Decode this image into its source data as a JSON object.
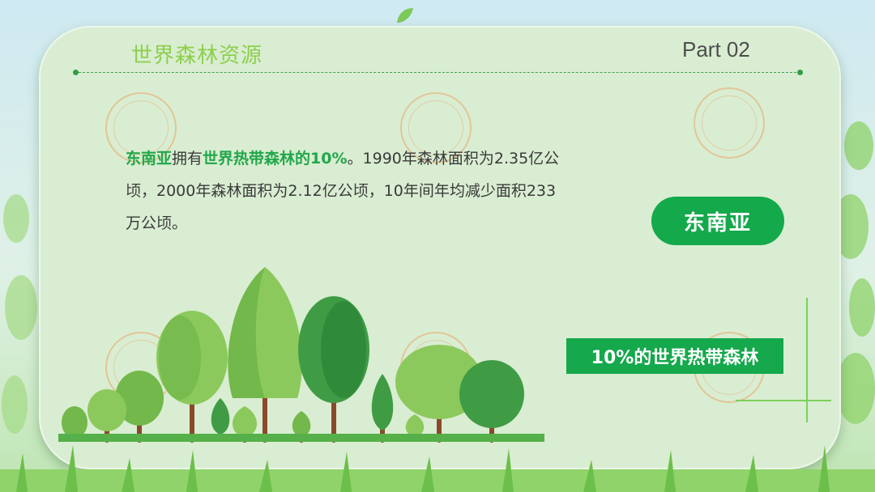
{
  "header": {
    "title": "世界森林资源",
    "part": "Part 02"
  },
  "content": {
    "segments": [
      {
        "text": "东南亚",
        "highlight": true
      },
      {
        "text": "拥有",
        "highlight": false
      },
      {
        "text": "世界热带森林的10%",
        "highlight": true
      },
      {
        "text": "。1990年森林面积为2.35亿公顷，2000年森林面积为2.12亿公顷，10年间年均减少面积233万公顷。",
        "highlight": false
      }
    ]
  },
  "pill_label": "东南亚",
  "banner_label": "10%的世界热带森林",
  "colors": {
    "accent": "#14a94b",
    "title": "#8ccf4b",
    "card": "#d9edd2"
  }
}
